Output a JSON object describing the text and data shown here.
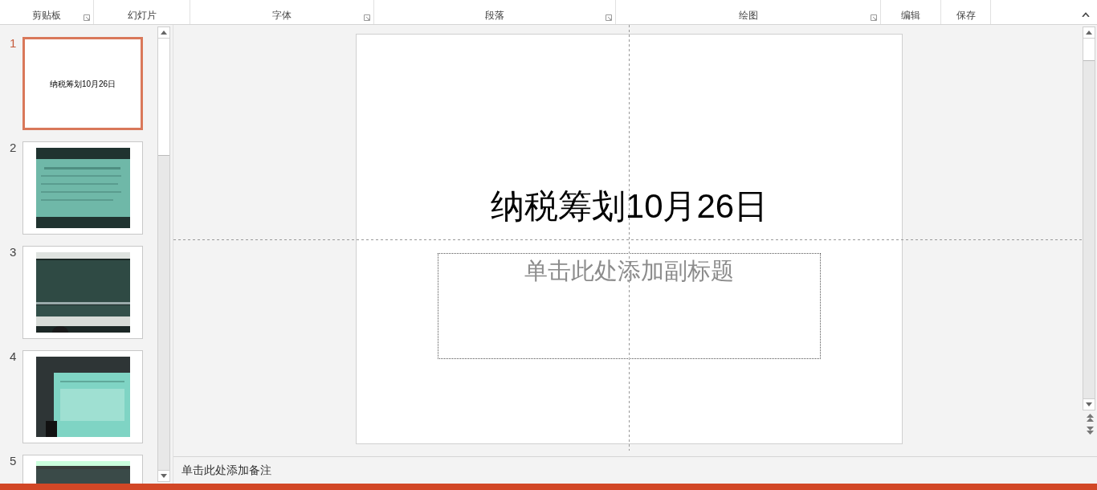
{
  "ribbon_groups": [
    {
      "label": "剪贴板",
      "launcher": true
    },
    {
      "label": "幻灯片",
      "launcher": false
    },
    {
      "label": "字体",
      "launcher": true
    },
    {
      "label": "段落",
      "launcher": true
    },
    {
      "label": "绘图",
      "launcher": true
    },
    {
      "label": "编辑",
      "launcher": false
    },
    {
      "label": "保存",
      "launcher": false
    }
  ],
  "slides": [
    {
      "number": "1",
      "selected": true,
      "kind": "title",
      "title": "纳税筹划10月26日"
    },
    {
      "number": "2",
      "selected": false,
      "kind": "picture"
    },
    {
      "number": "3",
      "selected": false,
      "kind": "picture"
    },
    {
      "number": "4",
      "selected": false,
      "kind": "picture"
    },
    {
      "number": "5",
      "selected": false,
      "kind": "picture"
    }
  ],
  "slide": {
    "title": "纳税筹划10月26日",
    "subtitle_placeholder": "单击此处添加副标题"
  },
  "notes": {
    "placeholder": "单击此处添加备注"
  }
}
